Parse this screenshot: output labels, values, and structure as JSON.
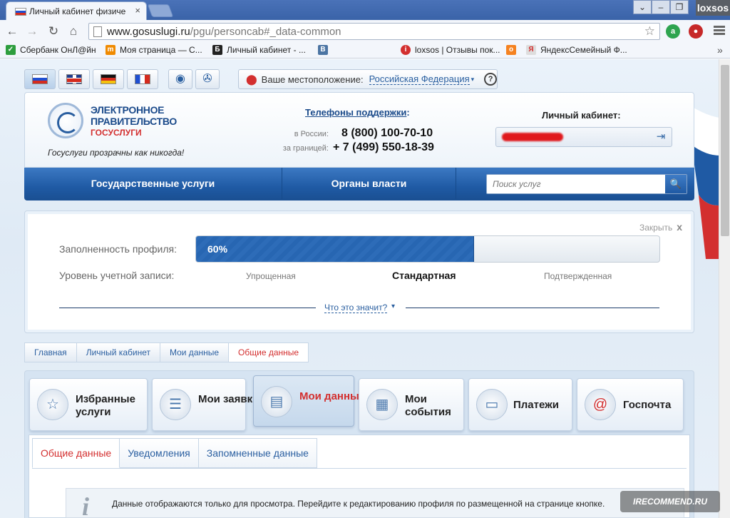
{
  "browser": {
    "tab_title": "Личный кабинет физиче",
    "tab_close": "×",
    "url_host": "www.gosuslugi.ru",
    "url_path": "/pgu/personcab#_data-common",
    "profile_name": "loxsos",
    "window_buttons": [
      "⌄",
      "–",
      "❐"
    ],
    "window_close": "✕"
  },
  "bookmarks": [
    {
      "label": "Сбербанк ОнЛ@йн",
      "icon": "sberbank-icon",
      "color": "#2e9e3e",
      "glyph": "✓"
    },
    {
      "label": "Моя страница — С...",
      "icon": "my-page-icon",
      "color": "#f08a00",
      "glyph": "m"
    },
    {
      "label": "Личный кабинет - ...",
      "icon": "cabinet-icon",
      "color": "#222222",
      "glyph": "Б"
    },
    {
      "label": "",
      "icon": "vk-icon",
      "color": "#4c75a3",
      "glyph": "В"
    },
    {
      "label": "loxsos | Отзывы пок...",
      "icon": "irecommend-icon",
      "color": "#d32f2f",
      "glyph": "i"
    },
    {
      "label": "",
      "icon": "odnoklassniki-icon",
      "color": "#f58220",
      "glyph": "о"
    },
    {
      "label": "ЯндексСемейный Ф...",
      "icon": "yandex-icon",
      "color": "#dddddd",
      "glyph": "Я"
    }
  ],
  "bookmarks_more": "»",
  "language": {
    "flags": [
      "ru",
      "uk",
      "de",
      "fr"
    ],
    "location_label": "Ваше местоположение:",
    "location_value": "Российская Федерация",
    "help": "?"
  },
  "header": {
    "logo_line1": "ЭЛЕКТРОННОЕ",
    "logo_line2": "ПРАВИТЕЛЬСТВО",
    "logo_line3": "ГОСУСЛУГИ",
    "slogan": "Госуслуги прозрачны как никогда!",
    "support_title": "Телефоны поддержки",
    "support_colon": ":",
    "phones": [
      {
        "label": "в России:",
        "number": "8 (800) 100-70-10"
      },
      {
        "label": "за границей:",
        "number": "+ 7 (499) 550-18-39"
      }
    ],
    "cabinet_title": "Личный кабинет:"
  },
  "nav": {
    "items": [
      "Государственные услуги",
      "Органы власти"
    ],
    "search_placeholder": "Поиск услуг",
    "search_icon": "🔍"
  },
  "profile": {
    "close_label": "Закрыть",
    "close_x": "x",
    "fill_label": "Заполненность профиля:",
    "fill_text": "60%",
    "fill_percent": 60,
    "level_label": "Уровень учетной записи:",
    "levels": [
      "Упрощенная",
      "Стандартная",
      "Подтвержденная"
    ],
    "current_level": 1,
    "what_link": "Что это значит?",
    "what_arrow": "▾"
  },
  "breadcrumbs": [
    "Главная",
    "Личный кабинет",
    "Мои данные",
    "Общие данные"
  ],
  "tiles": [
    {
      "label": "Избранные услуги",
      "icon": "favorites-icon",
      "glyph": "☆"
    },
    {
      "label": "Мои заявки",
      "icon": "requests-icon",
      "glyph": "☰"
    },
    {
      "label": "Мои данные",
      "icon": "my-data-icon",
      "glyph": "▤"
    },
    {
      "label": "Мои события",
      "icon": "calendar-icon",
      "glyph": "▦"
    },
    {
      "label": "Платежи",
      "icon": "payments-icon",
      "glyph": "▭"
    },
    {
      "label": "Госпочта",
      "icon": "mail-icon",
      "glyph": "@"
    }
  ],
  "active_tile": 2,
  "subtabs": [
    "Общие данные",
    "Уведомления",
    "Запомненные данные"
  ],
  "info": {
    "icon": "i",
    "text": "Данные отображаются только для просмотра. Перейдите к редактированию профиля по размещенной на странице кнопке."
  },
  "watermark": "IRECOMMEND.RU"
}
